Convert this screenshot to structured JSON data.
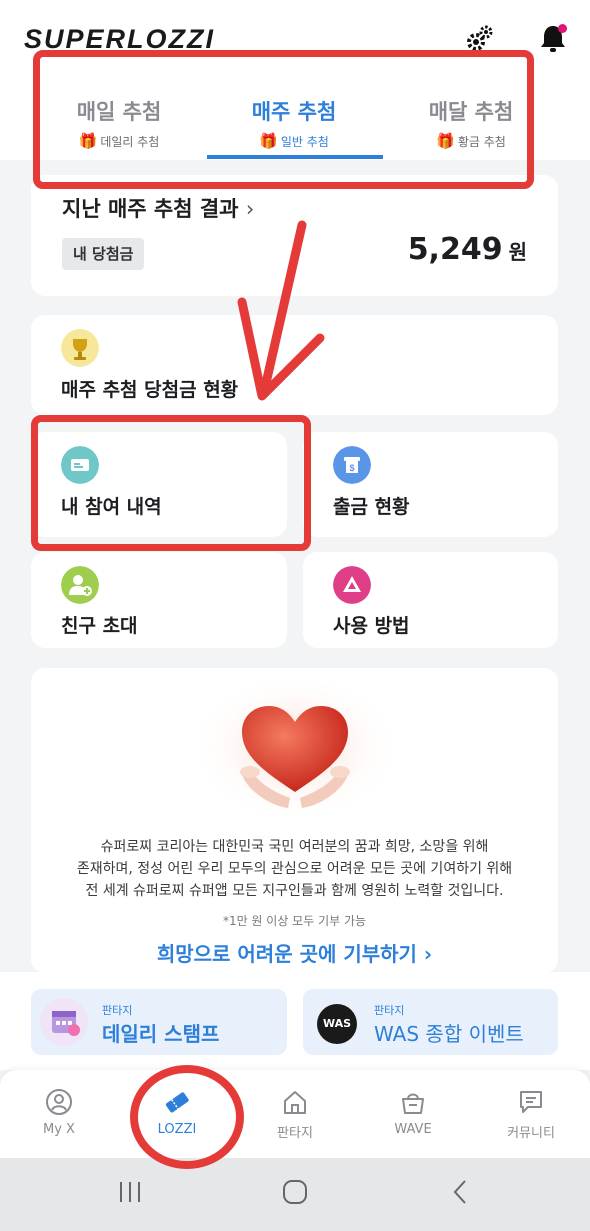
{
  "app": {
    "logo": "SUPERLOZZI"
  },
  "tabs": [
    {
      "label": "매일 추첨",
      "sub": "데일리 추첨"
    },
    {
      "label": "매주 추첨",
      "sub": "일반 추첨",
      "active": true
    },
    {
      "label": "매달 추첨",
      "sub": "황금 추첨"
    }
  ],
  "result": {
    "title": "지난 매주 추첨 결과",
    "chevron": "›",
    "my_label": "내 당첨금",
    "amount": "5,249",
    "unit": "원"
  },
  "menu": {
    "status": "매주 추첨 당첨금 현황",
    "history": "내 참여 내역",
    "withdraw": "출금 현황",
    "invite": "친구 초대",
    "howto": "사용 방법"
  },
  "hero": {
    "line1": "슈퍼로찌 코리아는 대한민국 국민 여러분의 꿈과 희망, 소망을 위해",
    "line2": "존재하며, 정성 어린 우리 모두의 관심으로 어려운 모든 곳에 기여하기 위해",
    "line3": "전 세계 슈퍼로찌 슈퍼앱 모든 지구인들과 함께 영원히 노력할 것입니다.",
    "note": "*1만 원 이상 모두 기부 가능",
    "donate": "희망으로 어려운 곳에 기부하기 ›"
  },
  "promos": [
    {
      "small": "판타지",
      "big": "데일리 스탬프"
    },
    {
      "small": "판타지",
      "big": "WAS 종합 이벤트",
      "badge": "WAS"
    }
  ],
  "nav": [
    "My X",
    "LOZZI",
    "판타지",
    "WAVE",
    "커뮤니티"
  ],
  "colors": {
    "accent": "#2d7fd9",
    "highlight": "#e43b39",
    "bell_dot": "#e0137a"
  },
  "icons": [
    "gear-icon",
    "bell-icon",
    "trophy-icon",
    "ticket-icon",
    "atm-icon",
    "add-friend-icon",
    "triangle-icon",
    "heart-hands-image",
    "calendar-icon",
    "user-circle-icon",
    "ticket-nav-icon",
    "home-icon",
    "basket-icon",
    "chat-icon"
  ]
}
